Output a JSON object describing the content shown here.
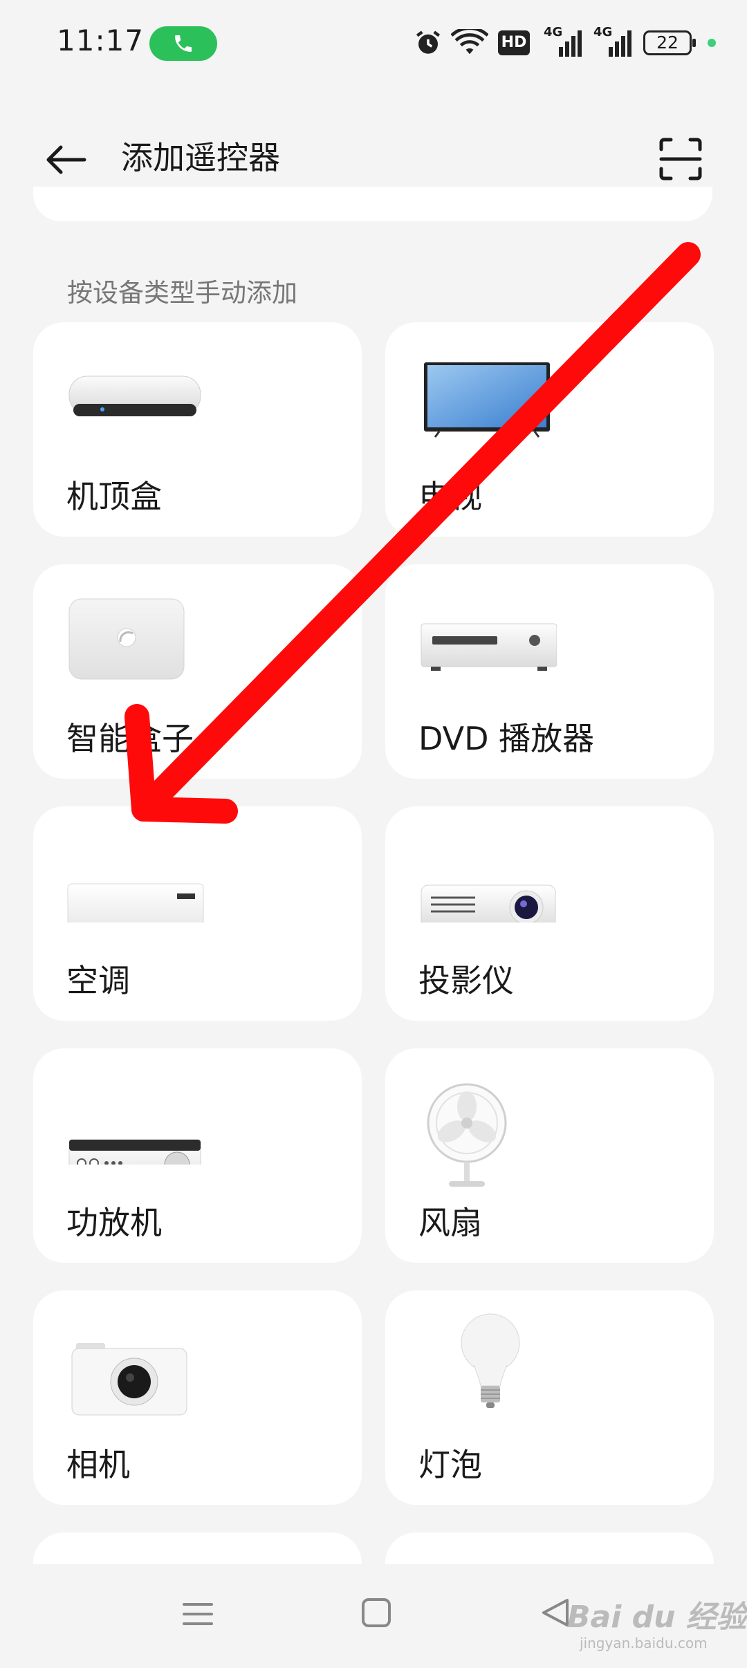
{
  "status": {
    "time": "11:17",
    "battery": "22",
    "network_1": "4G",
    "network_2": "4G",
    "hd": "HD"
  },
  "header": {
    "title": "添加遥控器"
  },
  "section": {
    "title": "按设备类型手动添加"
  },
  "devices": [
    {
      "label": "机顶盒",
      "icon": "set-top-box-icon"
    },
    {
      "label": "电视",
      "icon": "tv-icon"
    },
    {
      "label": "智能盒子",
      "icon": "smart-box-icon"
    },
    {
      "label": "DVD 播放器",
      "icon": "dvd-player-icon"
    },
    {
      "label": "空调",
      "icon": "air-conditioner-icon"
    },
    {
      "label": "投影仪",
      "icon": "projector-icon"
    },
    {
      "label": "功放机",
      "icon": "amplifier-icon"
    },
    {
      "label": "风扇",
      "icon": "fan-icon"
    },
    {
      "label": "相机",
      "icon": "camera-icon"
    },
    {
      "label": "灯泡",
      "icon": "light-bulb-icon"
    }
  ],
  "watermark": {
    "brand": "Bai du 经验",
    "url": "jingyan.baidu.com"
  },
  "colors": {
    "accent_green": "#2cc05a",
    "annotation_red": "#ff0a0a",
    "card_bg": "#ffffff",
    "page_bg": "#f4f4f4"
  }
}
